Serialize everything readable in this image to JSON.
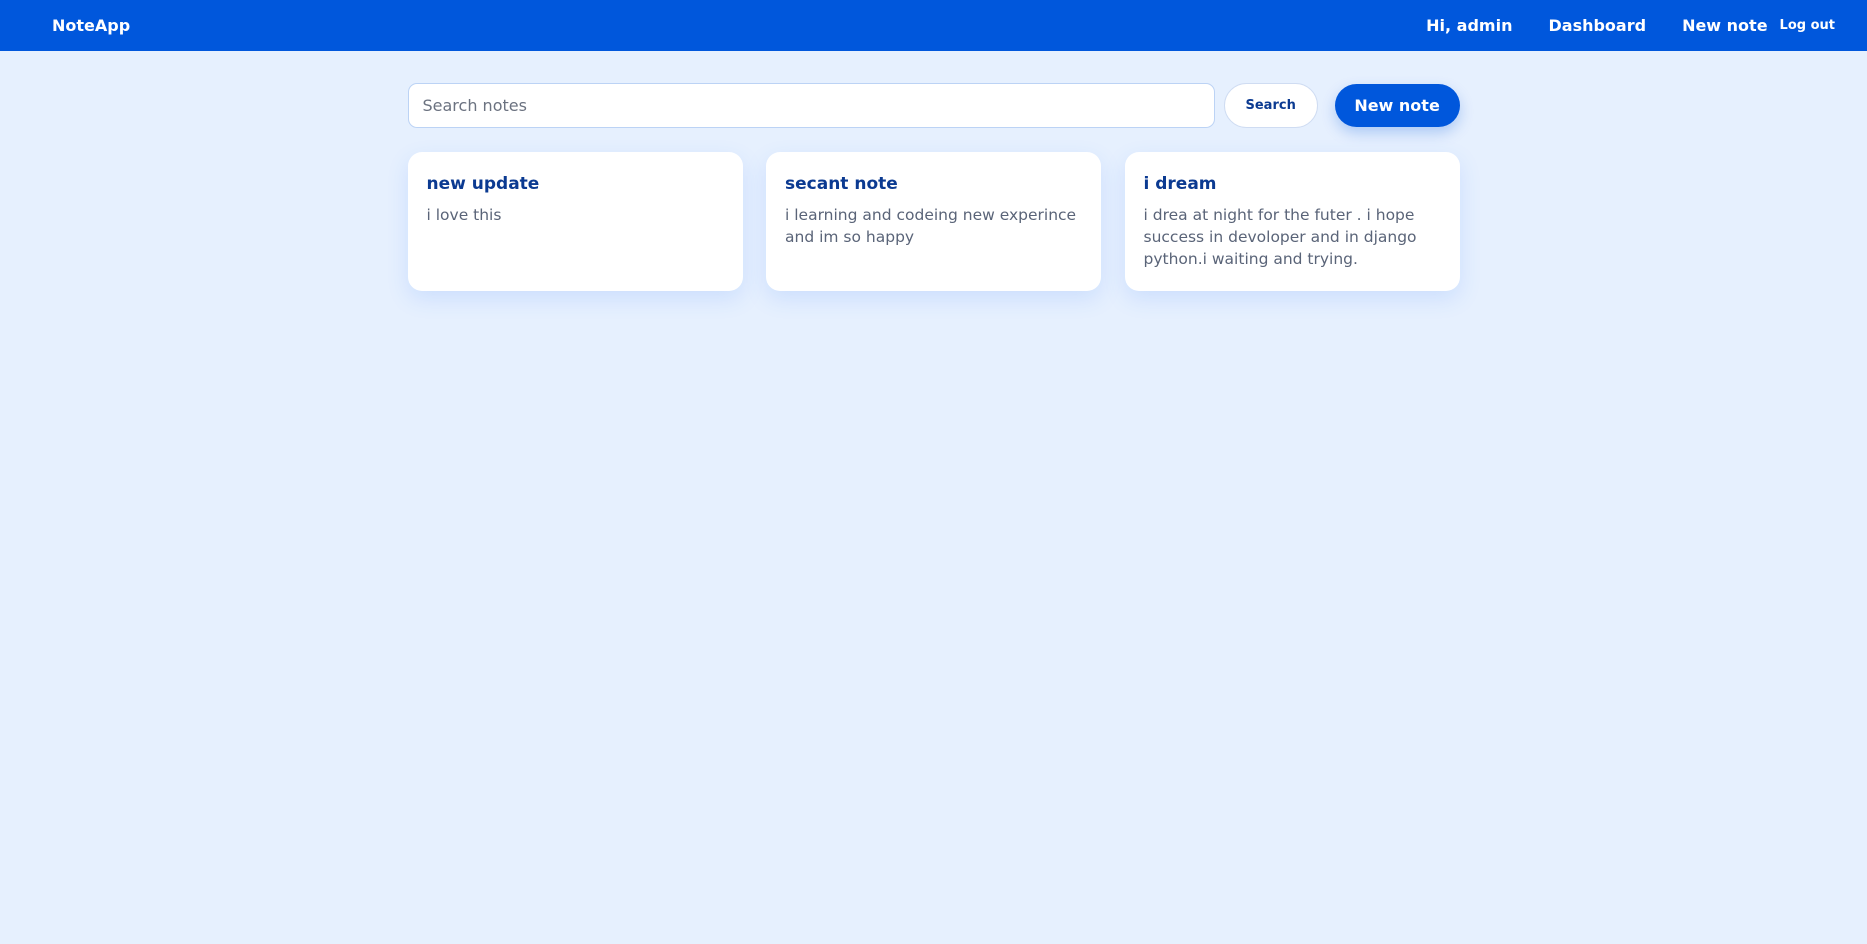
{
  "navbar": {
    "brand": "NoteApp",
    "greeting": "Hi, admin",
    "dashboard": "Dashboard",
    "new_note": "New note",
    "logout": "Log out"
  },
  "search": {
    "placeholder": "Search notes",
    "value": "",
    "button_label": "Search"
  },
  "actions": {
    "new_note_label": "New note"
  },
  "notes": [
    {
      "title": "new update",
      "body": "i love this"
    },
    {
      "title": "secant note",
      "body": "i learning and codeing new experince and im so happy"
    },
    {
      "title": "i dream",
      "body": "i drea at night for the futer . i hope success in devoloper and in django python.i waiting and trying."
    }
  ],
  "colors": {
    "primary": "#0057dc",
    "background": "#e6f0fe",
    "title": "#0b3a91",
    "body_text": "#5a6478"
  }
}
